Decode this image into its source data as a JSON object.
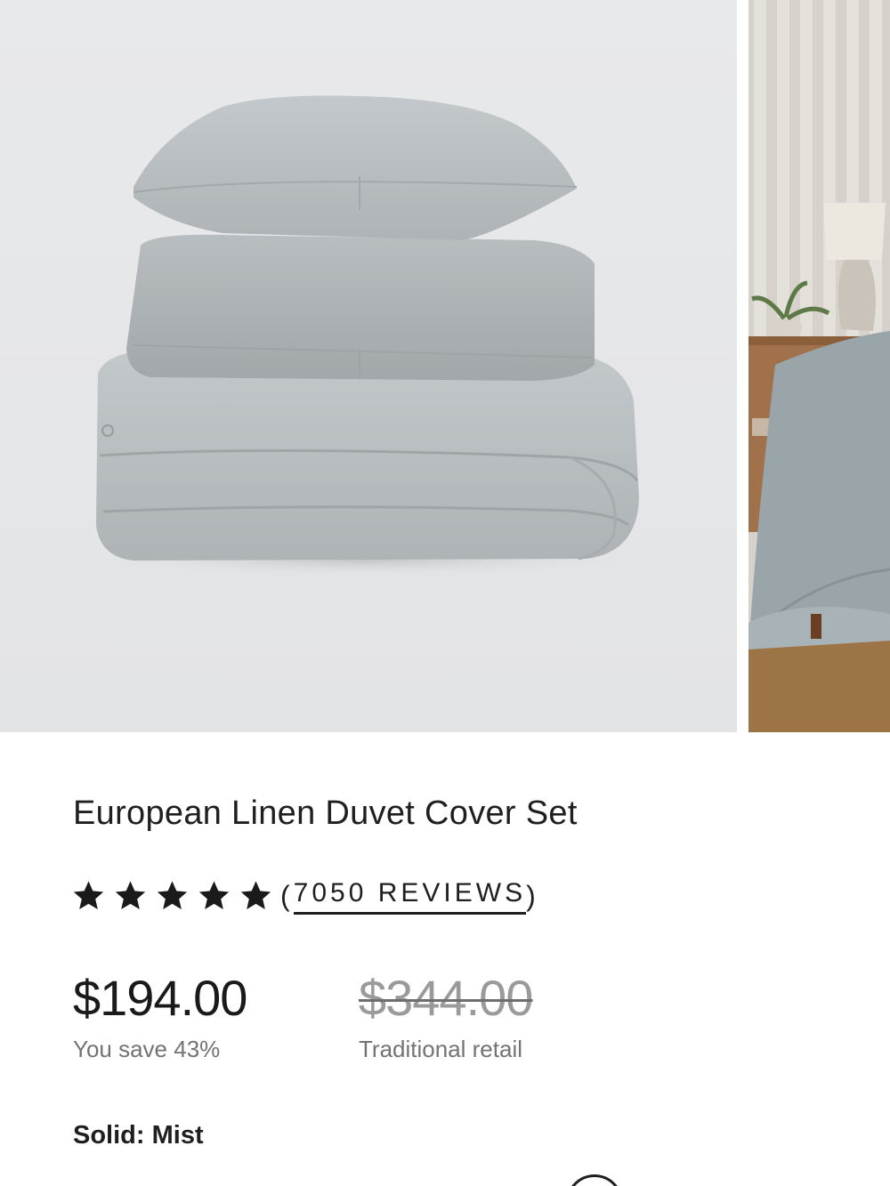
{
  "product": {
    "title": "European Linen Duvet Cover Set",
    "rating": {
      "stars": 5,
      "reviews_open": "(",
      "reviews_label": "7050 REVIEWS",
      "reviews_close": ")"
    },
    "price": {
      "sale": "$194.00",
      "sale_note": "You save 43%",
      "retail": "$344.00",
      "retail_note": "Traditional retail"
    },
    "color": {
      "label": "Solid:",
      "value": "Mist"
    }
  },
  "colors": {
    "gallery_bg": "#e6e7e9",
    "linen_mist": "#b9bec1",
    "text": "#1f1f1f",
    "muted": "#737373"
  }
}
